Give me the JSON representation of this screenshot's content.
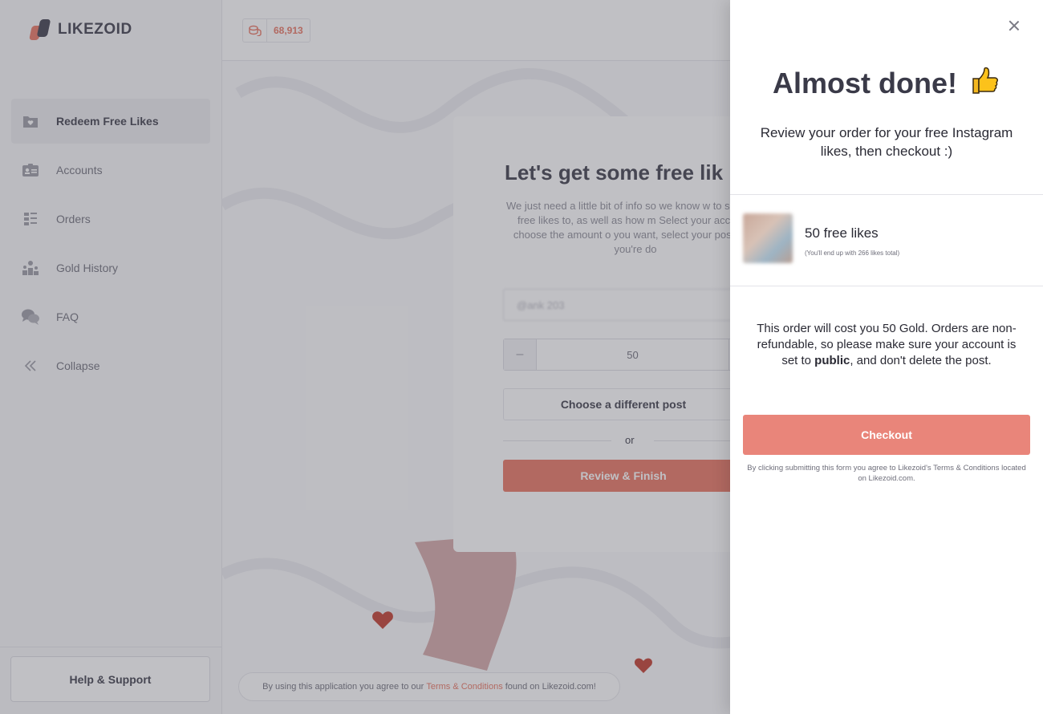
{
  "brand": {
    "name": "LIKEZOID"
  },
  "sidebar": {
    "items": [
      {
        "label": "Redeem Free Likes",
        "icon": "folder-heart-icon",
        "active": true
      },
      {
        "label": "Accounts",
        "icon": "id-card-icon",
        "active": false
      },
      {
        "label": "Orders",
        "icon": "list-icon",
        "active": false
      },
      {
        "label": "Gold History",
        "icon": "podium-icon",
        "active": false
      },
      {
        "label": "FAQ",
        "icon": "chat-bubbles-icon",
        "active": false
      },
      {
        "label": "Collapse",
        "icon": "double-chevron-left-icon",
        "active": false
      }
    ],
    "help_label": "Help & Support"
  },
  "topbar": {
    "gold_balance": "68,913",
    "gold_icon": "coins-icon"
  },
  "modal": {
    "title": "Let's get some free lik",
    "text": "We just need a little bit of info so we know w to send the free likes to, as well as how m Select your account, choose the amount o you want, select your post, and you're do",
    "account_value": "@ank 203",
    "quantity": "50",
    "minus_label": "–",
    "choose_post_label": "Choose a different post",
    "or_label": "or",
    "review_label": "Review & Finish"
  },
  "footer": {
    "prefix": "By using this application you agree to our",
    "link": "Terms & Conditions",
    "suffix": "found on Likezoid.com!"
  },
  "panel": {
    "title": "Almost done!",
    "title_icon": "thumbs-up-icon",
    "subtitle": "Review your order for your free Instagram likes, then checkout :)",
    "likes_title": "50 free likes",
    "likes_sub": "(You'll end up with 266 likes total)",
    "cost_before": "This order will cost you 50 Gold. Orders are non-refundable, so please make sure your account is set to",
    "cost_bold": "public",
    "cost_after": ", and don't delete the post.",
    "checkout_label": "Checkout",
    "legal": "By clicking submitting this form you agree to Likezoid's Terms & Conditions located on Likezoid.com."
  },
  "colors": {
    "accent": "#e8735f",
    "checkout": "#e9857a",
    "dark": "#3a3a48"
  }
}
